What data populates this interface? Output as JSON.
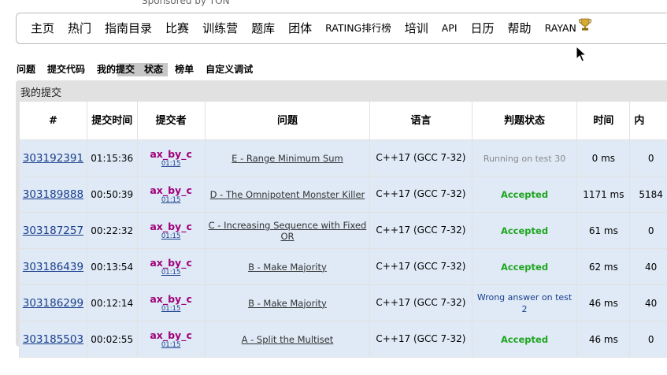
{
  "sponsor": "Sponsored by TON",
  "nav": {
    "items": [
      "主页",
      "热门",
      "指南目录",
      "比赛",
      "训练营",
      "题库",
      "团体",
      "RATING排行榜",
      "培训",
      "API",
      "日历",
      "帮助",
      "RAYAN"
    ],
    "trophy_icon": "trophy-icon"
  },
  "second_menu": {
    "items": [
      "问题",
      "提交代码",
      "我的提交",
      "状态",
      "榜单",
      "自定义调试"
    ]
  },
  "panel": {
    "title": "我的提交"
  },
  "table": {
    "headers": [
      "#",
      "提交时间",
      "提交者",
      "问题",
      "语言",
      "判题状态",
      "时间",
      "内"
    ],
    "rows": [
      {
        "id": "303192391",
        "when": "01:15:36",
        "author": "ax_by_c",
        "author_sub": "01:15",
        "problem": "E - Range Minimum Sum",
        "lang": "C++17 (GCC 7-32)",
        "verdict": "Running on test 30",
        "verdict_kind": "running",
        "time": "0 ms",
        "mem": "0"
      },
      {
        "id": "303189888",
        "when": "00:50:39",
        "author": "ax_by_c",
        "author_sub": "01:15",
        "problem": "D - The Omnipotent Monster Killer",
        "lang": "C++17 (GCC 7-32)",
        "verdict": "Accepted",
        "verdict_kind": "ok",
        "time": "1171 ms",
        "mem": "5184"
      },
      {
        "id": "303187257",
        "when": "00:22:32",
        "author": "ax_by_c",
        "author_sub": "01:15",
        "problem": "C - Increasing Sequence with Fixed OR",
        "lang": "C++17 (GCC 7-32)",
        "verdict": "Accepted",
        "verdict_kind": "ok",
        "time": "61 ms",
        "mem": "0"
      },
      {
        "id": "303186439",
        "when": "00:13:54",
        "author": "ax_by_c",
        "author_sub": "01:15",
        "problem": "B - Make Majority",
        "lang": "C++17 (GCC 7-32)",
        "verdict": "Accepted",
        "verdict_kind": "ok",
        "time": "62 ms",
        "mem": "40"
      },
      {
        "id": "303186299",
        "when": "00:12:14",
        "author": "ax_by_c",
        "author_sub": "01:15",
        "problem": "B - Make Majority",
        "lang": "C++17 (GCC 7-32)",
        "verdict": "Wrong answer on test 2",
        "verdict_kind": "wa",
        "time": "46 ms",
        "mem": "40"
      },
      {
        "id": "303185503",
        "when": "00:02:55",
        "author": "ax_by_c",
        "author_sub": "01:15",
        "problem": "A - Split the Multiset",
        "lang": "C++17 (GCC 7-32)",
        "verdict": "Accepted",
        "verdict_kind": "ok",
        "time": "46 ms",
        "mem": "0"
      }
    ]
  },
  "colors": {
    "accepted": "#1ea51e",
    "author": "#a0007a",
    "link": "#1a3e8c",
    "row_bg": "#dfeaf6",
    "panel_bg": "#e1e1e1"
  }
}
